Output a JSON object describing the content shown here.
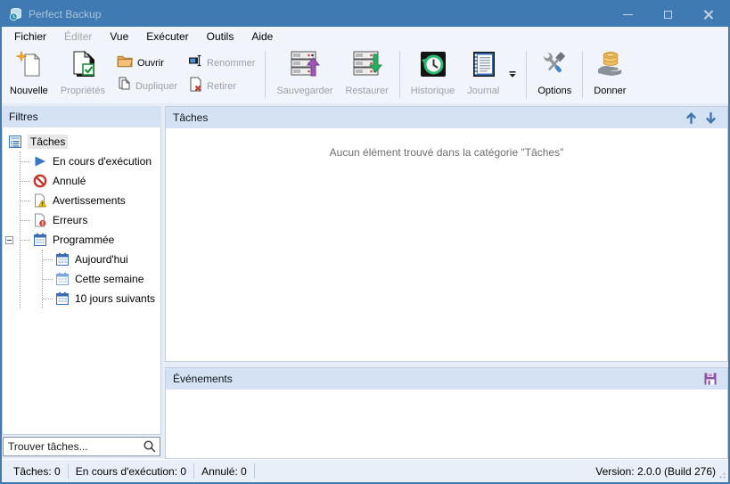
{
  "window": {
    "title": "Perfect Backup"
  },
  "menu": {
    "items": [
      {
        "label": "Fichier",
        "enabled": true
      },
      {
        "label": "Éditer",
        "enabled": false
      },
      {
        "label": "Vue",
        "enabled": true
      },
      {
        "label": "Exécuter",
        "enabled": true
      },
      {
        "label": "Outils",
        "enabled": true
      },
      {
        "label": "Aide",
        "enabled": true
      }
    ]
  },
  "toolbar": {
    "buttons": [
      {
        "label": "Nouvelle",
        "enabled": true,
        "icon": "new-task-icon"
      },
      {
        "label": "Propriétés",
        "enabled": false,
        "icon": "properties-icon"
      },
      {
        "label": "Ouvrir",
        "enabled": true,
        "icon": "open-folder-icon"
      },
      {
        "label": "Dupliquer",
        "enabled": false,
        "icon": "duplicate-icon"
      },
      {
        "label": "Renommer",
        "enabled": false,
        "icon": "rename-icon"
      },
      {
        "label": "Retirer",
        "enabled": false,
        "icon": "remove-icon"
      },
      {
        "label": "Sauvegarder",
        "enabled": false,
        "icon": "backup-icon"
      },
      {
        "label": "Restaurer",
        "enabled": false,
        "icon": "restore-icon"
      },
      {
        "label": "Historique",
        "enabled": false,
        "icon": "history-icon"
      },
      {
        "label": "Journal",
        "enabled": false,
        "icon": "journal-icon"
      },
      {
        "label": "Options",
        "enabled": true,
        "icon": "options-icon"
      },
      {
        "label": "Donner",
        "enabled": true,
        "icon": "donate-icon"
      }
    ]
  },
  "sidebar": {
    "header": "Filtres",
    "tree": [
      {
        "label": "Tâches",
        "icon": "task-list-icon",
        "selected": true
      },
      {
        "label": "En cours d'exécution",
        "icon": "running-icon"
      },
      {
        "label": "Annulé",
        "icon": "cancelled-icon"
      },
      {
        "label": "Avertissements",
        "icon": "warnings-icon"
      },
      {
        "label": "Erreurs",
        "icon": "errors-icon"
      },
      {
        "label": "Programmée",
        "icon": "calendar-icon",
        "expanded": true
      },
      {
        "label": "Aujourd'hui",
        "icon": "calendar-icon"
      },
      {
        "label": "Cette semaine",
        "icon": "calendar-light-icon"
      },
      {
        "label": "10 jours suivants",
        "icon": "calendar-icon"
      }
    ],
    "search_placeholder": "Trouver tâches..."
  },
  "main": {
    "tasks_panel": {
      "title": "Tâches",
      "empty_message": "Aucun élément trouvé dans la catégorie \"Tâches\""
    },
    "events_panel": {
      "title": "Événements"
    }
  },
  "statusbar": {
    "items": [
      "Tâches: 0",
      "En cours d'exécution: 0",
      "Annulé: 0"
    ],
    "version": "Version: 2.0.0 (Build 276)"
  },
  "colors": {
    "titlebar": "#3f7ab2",
    "panel_header": "#d4e2f3",
    "disabled_text": "#9ba1a8",
    "arrow_blue": "#3f74ad",
    "save_purple": "#8e4fa8",
    "folder_orange": "#e9a84c",
    "coin_gold": "#f0c060",
    "history_green": "#2eb872",
    "error_red": "#d64541",
    "warning_yellow": "#f1c40f",
    "play_blue": "#3a76c4"
  }
}
